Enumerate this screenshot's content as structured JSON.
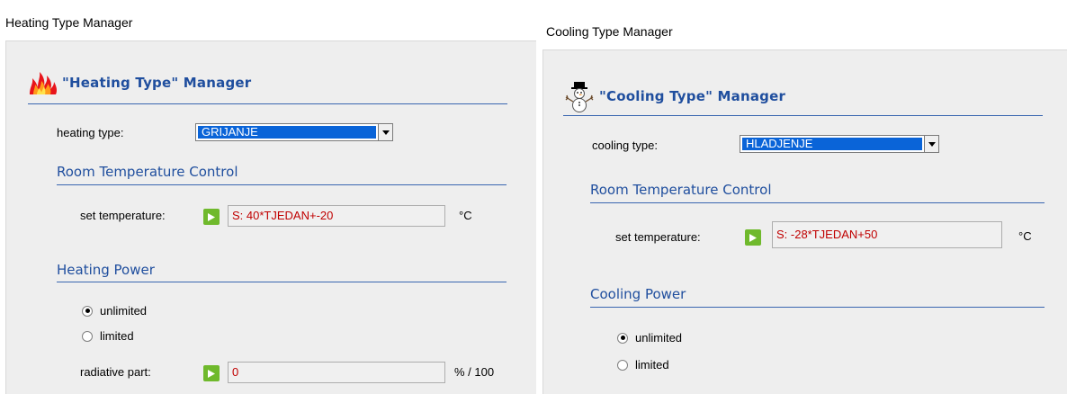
{
  "heating": {
    "window_title": "Heating Type Manager",
    "header": "\"Heating Type\" Manager",
    "icon": "fire-icon",
    "type_label": "heating type:",
    "type_value": "GRIJANJE",
    "room_section": "Room Temperature Control",
    "set_temp_label": "set temperature:",
    "set_temp_value": "S: 40*TJEDAN+-20",
    "temp_unit": "°C",
    "power_section": "Heating Power",
    "power_options": [
      "unlimited",
      "limited"
    ],
    "power_selected": "unlimited",
    "radiative_label": "radiative part:",
    "radiative_value": "0",
    "radiative_unit": "% / 100"
  },
  "cooling": {
    "window_title": "Cooling Type Manager",
    "header": "\"Cooling Type\" Manager",
    "icon": "snowman-icon",
    "type_label": "cooling type:",
    "type_value": "HLADJENJE",
    "room_section": "Room Temperature Control",
    "set_temp_label": "set temperature:",
    "set_temp_value": "S: -28*TJEDAN+50",
    "temp_unit": "°C",
    "power_section": "Cooling Power",
    "power_options": [
      "unlimited",
      "limited"
    ],
    "power_selected": "unlimited"
  },
  "colors": {
    "header_blue": "#1f4e9e",
    "value_red": "#c00000",
    "selection_blue": "#0a64d8",
    "play_green": "#6fb92c",
    "panel_gray": "#eeeeee"
  }
}
